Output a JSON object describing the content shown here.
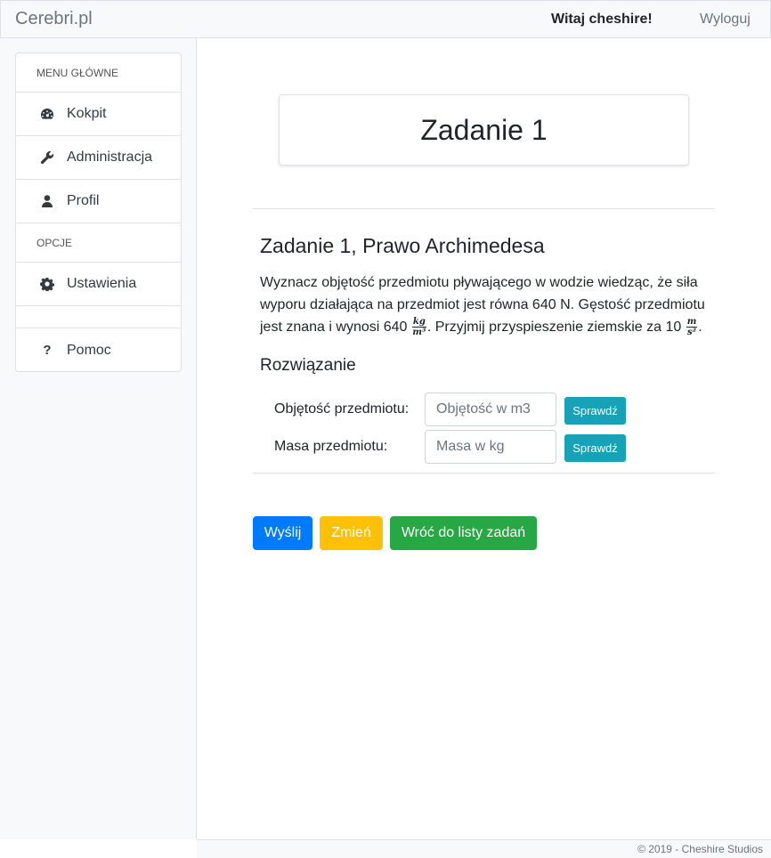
{
  "header": {
    "brand": "Cerebri.pl",
    "welcome": "Witaj cheshire!",
    "logout": "Wyloguj"
  },
  "sidebar": {
    "main_heading": "MENU GŁÓWNE",
    "items": [
      {
        "label": "Kokpit",
        "icon": "dashboard-icon"
      },
      {
        "label": "Administracja",
        "icon": "wrench-icon"
      },
      {
        "label": "Profil",
        "icon": "user-icon"
      }
    ],
    "options_heading": "OPCJE",
    "options": [
      {
        "label": "Ustawienia",
        "icon": "gear-icon"
      }
    ],
    "help": {
      "label": "Pomoc",
      "icon": "question-icon",
      "glyph": "?"
    }
  },
  "main": {
    "card_title": "Zadanie 1",
    "task_title": "Zadanie 1, Prawo Archimedesa",
    "task_text_part1": "Wyznacz objętość przedmiotu pływającego w wodzie wiedząc, że siła wyporu działająca na przedmiot jest równa 640 N. Gęstość przedmiotu jest znana i wynosi 640",
    "density_unit_num": "kg",
    "density_unit_den": "m³",
    "task_text_part2": ". Przyjmij przyspieszenie ziemskie za 10",
    "accel_unit_num": "m",
    "accel_unit_den": "s²",
    "task_text_part3": ".",
    "solution_title": "Rozwiązanie",
    "fields": [
      {
        "label": "Objętość przedmiotu:",
        "placeholder": "Objętość w m3",
        "button": "Sprawdź"
      },
      {
        "label": "Masa przedmiotu:",
        "placeholder": "Masa w kg",
        "button": "Sprawdź"
      }
    ],
    "buttons": {
      "send": "Wyślij",
      "change": "Zmień",
      "back": "Wróć do listy zadań"
    }
  },
  "footer": {
    "text": "© 2019 - Cheshire Studios"
  },
  "colors": {
    "primary": "#007bff",
    "warning": "#ffc107",
    "success": "#28a745",
    "info": "#17a2b8"
  }
}
